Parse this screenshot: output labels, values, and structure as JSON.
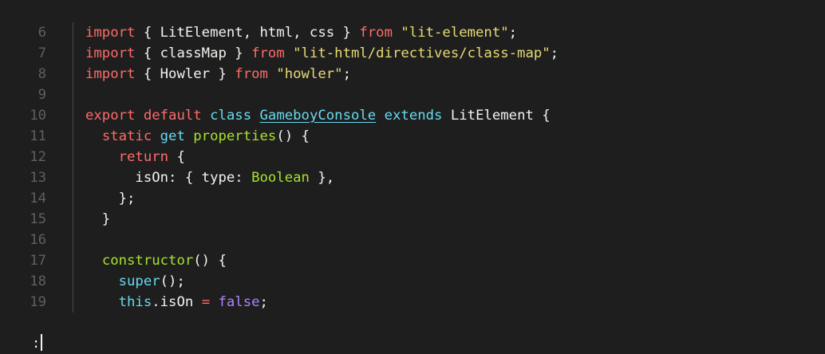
{
  "editor": {
    "lines": [
      {
        "num": "6",
        "tokens": [
          {
            "t": "import",
            "c": "kw"
          },
          {
            "t": " { LitElement, html, css } ",
            "c": "plain"
          },
          {
            "t": "from",
            "c": "kw"
          },
          {
            "t": " ",
            "c": "plain"
          },
          {
            "t": "\"lit-element\"",
            "c": "str"
          },
          {
            "t": ";",
            "c": "plain"
          }
        ]
      },
      {
        "num": "7",
        "tokens": [
          {
            "t": "import",
            "c": "kw"
          },
          {
            "t": " { classMap } ",
            "c": "plain"
          },
          {
            "t": "from",
            "c": "kw"
          },
          {
            "t": " ",
            "c": "plain"
          },
          {
            "t": "\"lit-html/directives/class-map\"",
            "c": "str"
          },
          {
            "t": ";",
            "c": "plain"
          }
        ]
      },
      {
        "num": "8",
        "tokens": [
          {
            "t": "import",
            "c": "kw"
          },
          {
            "t": " { Howler } ",
            "c": "plain"
          },
          {
            "t": "from",
            "c": "kw"
          },
          {
            "t": " ",
            "c": "plain"
          },
          {
            "t": "\"howler\"",
            "c": "str"
          },
          {
            "t": ";",
            "c": "plain"
          }
        ]
      },
      {
        "num": "9",
        "tokens": []
      },
      {
        "num": "10",
        "tokens": [
          {
            "t": "export",
            "c": "kw"
          },
          {
            "t": " ",
            "c": "plain"
          },
          {
            "t": "default",
            "c": "kw"
          },
          {
            "t": " ",
            "c": "plain"
          },
          {
            "t": "class",
            "c": "blue"
          },
          {
            "t": " ",
            "c": "plain"
          },
          {
            "t": "GameboyConsole",
            "c": "cls"
          },
          {
            "t": " ",
            "c": "plain"
          },
          {
            "t": "extends",
            "c": "blue"
          },
          {
            "t": " LitElement {",
            "c": "plain"
          }
        ]
      },
      {
        "num": "11",
        "tokens": [
          {
            "t": "  ",
            "c": "plain"
          },
          {
            "t": "static",
            "c": "kw"
          },
          {
            "t": " ",
            "c": "plain"
          },
          {
            "t": "get",
            "c": "blue"
          },
          {
            "t": " ",
            "c": "plain"
          },
          {
            "t": "properties",
            "c": "fn"
          },
          {
            "t": "() {",
            "c": "plain"
          }
        ]
      },
      {
        "num": "12",
        "tokens": [
          {
            "t": "    ",
            "c": "plain"
          },
          {
            "t": "return",
            "c": "kw"
          },
          {
            "t": " {",
            "c": "plain"
          }
        ]
      },
      {
        "num": "13",
        "tokens": [
          {
            "t": "      isOn: { type: ",
            "c": "plain"
          },
          {
            "t": "Boolean",
            "c": "type"
          },
          {
            "t": " },",
            "c": "plain"
          }
        ]
      },
      {
        "num": "14",
        "tokens": [
          {
            "t": "    };",
            "c": "plain"
          }
        ]
      },
      {
        "num": "15",
        "tokens": [
          {
            "t": "  }",
            "c": "plain"
          }
        ]
      },
      {
        "num": "16",
        "tokens": []
      },
      {
        "num": "17",
        "tokens": [
          {
            "t": "  ",
            "c": "plain"
          },
          {
            "t": "constructor",
            "c": "fn"
          },
          {
            "t": "() {",
            "c": "plain"
          }
        ]
      },
      {
        "num": "18",
        "tokens": [
          {
            "t": "    ",
            "c": "plain"
          },
          {
            "t": "super",
            "c": "blue"
          },
          {
            "t": "();",
            "c": "plain"
          }
        ]
      },
      {
        "num": "19",
        "tokens": [
          {
            "t": "    ",
            "c": "plain"
          },
          {
            "t": "this",
            "c": "blue"
          },
          {
            "t": ".isOn ",
            "c": "plain"
          },
          {
            "t": "=",
            "c": "kw"
          },
          {
            "t": " ",
            "c": "plain"
          },
          {
            "t": "false",
            "c": "purple"
          },
          {
            "t": ";",
            "c": "plain"
          }
        ]
      }
    ]
  },
  "cmdline": {
    "prompt": ":"
  },
  "colors": {
    "background": "#1e1e1e",
    "keyword": "#ff6b68",
    "string": "#e6db74",
    "storage": "#66d9ef",
    "function": "#a6e22e",
    "constant": "#ae81ff",
    "line_number": "#5f5f5f"
  }
}
